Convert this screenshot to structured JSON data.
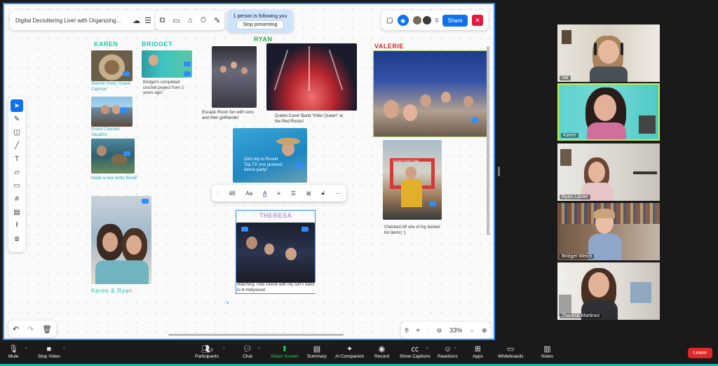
{
  "meeting": {
    "board_title": "Digital Decluttering Live! with Organizing...",
    "follow_text": "1 person is following you",
    "stop_presenting": "Stop presenting",
    "participant_count": "5",
    "share_label": "Share",
    "zoom_level": "33%",
    "font_size": "48"
  },
  "board": {
    "names": {
      "karen": "KAREN",
      "bridget": "BRIDGET",
      "ryan": "RYAN",
      "valerie": "VALERIE",
      "theresa": "THERESA",
      "karen_ryan": "Karen & Ryan"
    },
    "captions": {
      "starfish": "Starfish Point, Grand Cayman",
      "cayman": "Grand Cayman Vacation",
      "turtle": "Made  a  new  turtle friend!",
      "crochet": "Bridget's completed crochet project from 2 years ago!",
      "escape": "Escape Room fun with sons and their girlfriends!",
      "queen": "Queen Cover Band \"Killer Queen\" at the Red Rocks!",
      "girls_trip": "Girls trip to Round Top TX (not pictured: dance party!",
      "bucket": "Checked off  one of my bucket list items! :)",
      "tribe": "Watching Tribe Divine with my son's band in N Hollywood",
      "frame_text": "IT'S MY FIRST TIME"
    }
  },
  "participants": [
    {
      "name": "Val"
    },
    {
      "name": "Karen"
    },
    {
      "name": "Ryan Lanier"
    },
    {
      "name": "Bridget Welch"
    },
    {
      "name": "Theresa Martinez"
    }
  ],
  "toolbar": {
    "mute": "Mute",
    "stop_video": "Stop Video",
    "participants": "Participants",
    "participants_count": "5",
    "chat": "Chat",
    "share_screen": "Share Screen",
    "summary": "Summary",
    "ai_companion": "AI Companion",
    "record": "Record",
    "show_captions": "Show Captions",
    "reactions": "Reactions",
    "apps": "Apps",
    "whiteboards": "Whiteboards",
    "notes": "Notes",
    "leave": "Leave"
  },
  "colors": {
    "accent": "#0e72ed",
    "karen": "#21c4b4",
    "bridget": "#21c4b4",
    "ryan": "#2aa84a",
    "valerie": "#cc2a2a",
    "theresa": "#b79be0",
    "active_speaker": "#c8f23d",
    "share_green": "#23d959"
  }
}
